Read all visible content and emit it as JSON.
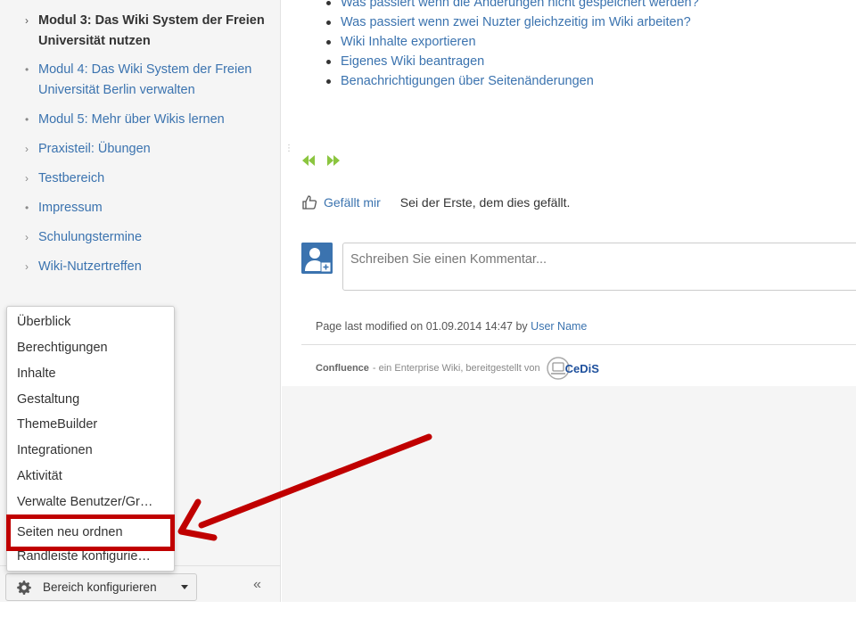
{
  "sidebar": {
    "items": [
      {
        "label": "Modul 3: Das Wiki System der Freien Universität nutzen",
        "marker": "›",
        "current": true
      },
      {
        "label": "Modul 4: Das Wiki System der Freien Universität Berlin verwalten",
        "marker": "•",
        "current": false
      },
      {
        "label": "Modul 5: Mehr über Wikis lernen",
        "marker": "•",
        "current": false
      },
      {
        "label": "Praxisteil: Übungen",
        "marker": "›",
        "current": false
      },
      {
        "label": "Testbereich",
        "marker": "›",
        "current": false
      },
      {
        "label": "Impressum",
        "marker": "•",
        "current": false
      },
      {
        "label": "Schulungstermine",
        "marker": "›",
        "current": false
      },
      {
        "label": "Wiki-Nutzertreffen",
        "marker": "›",
        "current": false
      }
    ],
    "footer": {
      "config_label": "Bereich konfigurieren",
      "gear_icon": "gear-icon",
      "collapse_icon": "«"
    }
  },
  "menu": {
    "items": [
      "Überblick",
      "Berechtigungen",
      "Inhalte",
      "Gestaltung",
      "ThemeBuilder",
      "Integrationen",
      "Aktivität",
      "Verwalte Benutzer/Gr…",
      "Seiten neu ordnen",
      "Randleiste konfigurie…"
    ],
    "highlighted": "Seiten neu ordnen"
  },
  "content": {
    "bullets": [
      "Was passiert wenn die Änderungen nicht gespeichert werden?",
      "Was passiert wenn zwei Nuzter gleichzeitig im Wiki arbeiten?",
      "Wiki Inhalte exportieren",
      "Eigenes Wiki beantragen",
      "Benachrichtigungen über Seitenänderungen"
    ],
    "like_label": "Gefällt mir",
    "like_text": "Sei der Erste, dem dies gefällt.",
    "comment_placeholder": "Schreiben Sie einen Kommentar...",
    "modified_prefix": "Page last modified on 01.09.2014 14:47 by",
    "modified_user": "User Name",
    "powered_brand": "Confluence",
    "powered_text": "- ein Enterprise Wiki, bereitgestellt von",
    "powered_logo": "CeDiS"
  },
  "colors": {
    "link": "#3b73af",
    "highlight": "#c00000",
    "pager_green": "#8bc53f"
  }
}
